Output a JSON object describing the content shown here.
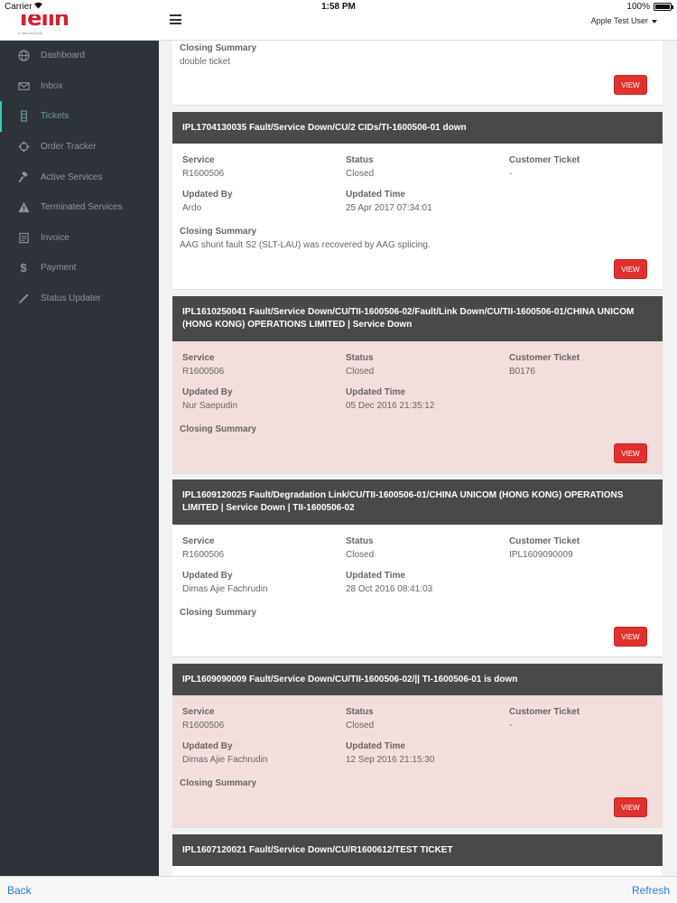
{
  "status_bar": {
    "carrier": "Carrier",
    "time": "1:58 PM",
    "battery": "100%"
  },
  "header": {
    "logo": "Telin",
    "logo_sub": "a TelkomGroup",
    "user": "Apple Test User"
  },
  "sidebar": {
    "items": [
      {
        "label": "Dashboard",
        "icon": "globe-icon"
      },
      {
        "label": "Inbox",
        "icon": "envelope-icon"
      },
      {
        "label": "Tickets",
        "icon": "ticket-icon",
        "active": true
      },
      {
        "label": "Order Tracker",
        "icon": "crosshair-icon"
      },
      {
        "label": "Active Services",
        "icon": "gavel-icon"
      },
      {
        "label": "Terminated Services",
        "icon": "warning-icon"
      },
      {
        "label": "Invoice",
        "icon": "document-icon"
      },
      {
        "label": "Payment",
        "icon": "dollar-icon"
      },
      {
        "label": "Status Updater",
        "icon": "pencil-icon"
      }
    ]
  },
  "labels": {
    "service": "Service",
    "status": "Status",
    "customer_ticket": "Customer Ticket",
    "updated_by": "Updated By",
    "updated_time": "Updated Time",
    "closing_summary": "Closing Summary",
    "view": "VIEW"
  },
  "tickets": [
    {
      "closing_summary": "double ticket"
    },
    {
      "title": "IPL1704130035 Fault/Service Down/CU/2 CIDs/TI-1600506-01 down",
      "service": "R1600506",
      "status": "Closed",
      "customer_ticket": "-",
      "updated_by": "Ardo",
      "updated_time": "25 Apr 2017 07:34:01",
      "closing_summary": "AAG shunt fault S2 (SLT-LAU) was recovered by AAG splicing."
    },
    {
      "title": "IPL1610250041 Fault/Service Down/CU/TII-1600506-02/Fault/Link Down/CU/TII-1600506-01/CHINA UNICOM (HONG KONG) OPERATIONS LIMITED | Service Down",
      "service": "R1600506",
      "status": "Closed",
      "customer_ticket": "B0176",
      "updated_by": "Nur Saepudin",
      "updated_time": "05 Dec 2016 21:35:12",
      "closing_summary": ""
    },
    {
      "title": "IPL1609120025 Fault/Degradation Link/CU/TII-1600506-01/CHINA UNICOM (HONG KONG) OPERATIONS LIMITED | Service Down | TII-1600506-02",
      "service": "R1600506",
      "status": "Closed",
      "customer_ticket": "IPL1609090009",
      "updated_by": "Dimas Ajie Fachrudin",
      "updated_time": "28 Oct 2016 08:41:03",
      "closing_summary": ""
    },
    {
      "title": "IPL1609090009 Fault/Service Down/CU/TII-1600506-02/|| TI-1600506-01 is down",
      "service": "R1600506",
      "status": "Closed",
      "customer_ticket": "-",
      "updated_by": "Dimas Ajie Fachrudin",
      "updated_time": "12 Sep 2016 21:15:30",
      "closing_summary": ""
    },
    {
      "title": "IPL1607120021 Fault/Service Down/CU/R1600612/TEST TICKET"
    }
  ],
  "bottom_bar": {
    "back": "Back",
    "refresh": "Refresh"
  }
}
